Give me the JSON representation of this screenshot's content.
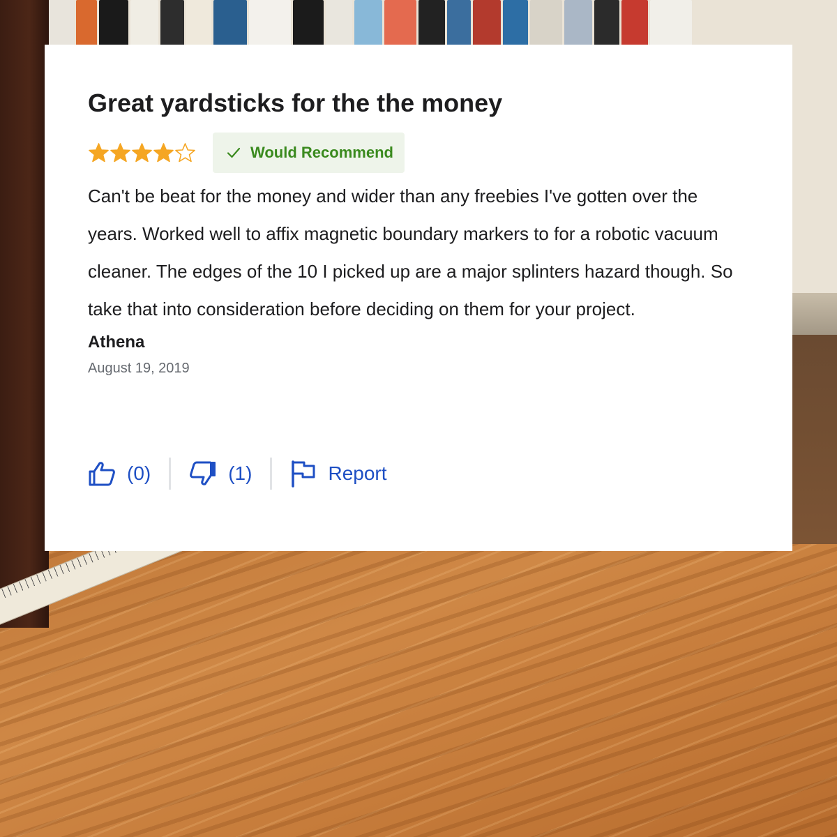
{
  "review": {
    "title": "Great yardsticks for the the money",
    "rating": 4,
    "rating_max": 5,
    "badge_label": "Would Recommend",
    "body": "Can't be beat for the money and wider than any freebies I've gotten over the years. Worked well to affix magnetic boundary markers to for a robotic vacuum cleaner. The edges of the 10 I picked up are a major splinters hazard though. So take that into consideration before deciding on them for your project.",
    "author": "Athena",
    "date": "August 19, 2019"
  },
  "actions": {
    "helpful_count": "(0)",
    "unhelpful_count": "(1)",
    "report_label": "Report"
  },
  "icons": {
    "star": "star-icon",
    "check": "checkmark-icon",
    "thumbs_up": "thumbs-up-icon",
    "thumbs_down": "thumbs-down-icon",
    "flag": "flag-icon"
  },
  "colors": {
    "star": "#f5a623",
    "badge_bg": "#eef4ea",
    "badge_text": "#3a8a1e",
    "link": "#1e4fc4",
    "text": "#1d1d1f",
    "muted": "#666a70"
  }
}
